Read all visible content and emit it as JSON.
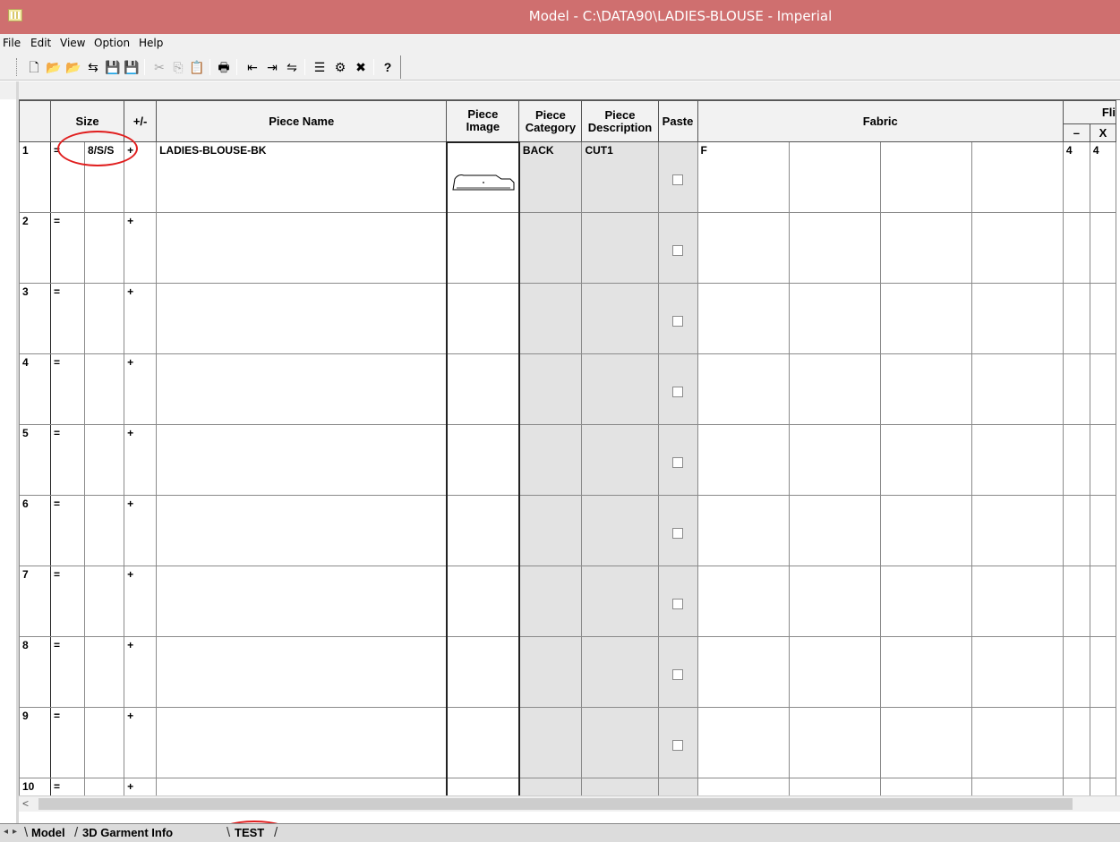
{
  "window": {
    "title": "Model - C:\\DATA90\\LADIES-BLOUSE - Imperial"
  },
  "menu": [
    "File",
    "Edit",
    "View",
    "Option",
    "Help"
  ],
  "toolbar": {
    "icons": [
      "new-icon",
      "open-icon",
      "open-folder-icon",
      "import-icon",
      "save-icon",
      "save-all-icon",
      "cut-icon",
      "copy-icon",
      "paste-icon",
      "print-icon",
      "insert-row-icon",
      "append-row-icon",
      "delete-row-icon",
      "sort-icon",
      "properties-icon",
      "delete-icon",
      "help-icon"
    ],
    "glyphs": [
      "🗋",
      "📂",
      "📂",
      "⇆",
      "💾",
      "💾",
      "✂",
      "⎘",
      "📋",
      "🖶",
      "⇤",
      "⇥",
      "⇋",
      "☰",
      "⚙",
      "✖",
      "?"
    ]
  },
  "columns": {
    "size": "Size",
    "plusminus": "+/-",
    "piece_name": "Piece Name",
    "piece_image": "Piece\nImage",
    "piece_category": "Piece\nCategory",
    "piece_description": "Piece\nDescription",
    "paste": "Paste",
    "fabric": "Fabric",
    "flip": "Fli",
    "flip_minus": "–",
    "flip_x": "X"
  },
  "rows": [
    {
      "num": "1",
      "eq": "=",
      "size": "8/S/S",
      "plus": "+",
      "name": "LADIES-BLOUSE-BK",
      "category": "BACK",
      "description": "CUT1",
      "fabric": "F",
      "flip_minus": "4",
      "flip_x": "4",
      "has_image": true
    },
    {
      "num": "2",
      "eq": "=",
      "size": "",
      "plus": "+",
      "name": "",
      "category": "",
      "description": "",
      "fabric": "",
      "flip_minus": "",
      "flip_x": ""
    },
    {
      "num": "3",
      "eq": "=",
      "size": "",
      "plus": "+",
      "name": "",
      "category": "",
      "description": "",
      "fabric": "",
      "flip_minus": "",
      "flip_x": ""
    },
    {
      "num": "4",
      "eq": "=",
      "size": "",
      "plus": "+",
      "name": "",
      "category": "",
      "description": "",
      "fabric": "",
      "flip_minus": "",
      "flip_x": ""
    },
    {
      "num": "5",
      "eq": "=",
      "size": "",
      "plus": "+",
      "name": "",
      "category": "",
      "description": "",
      "fabric": "",
      "flip_minus": "",
      "flip_x": ""
    },
    {
      "num": "6",
      "eq": "=",
      "size": "",
      "plus": "+",
      "name": "",
      "category": "",
      "description": "",
      "fabric": "",
      "flip_minus": "",
      "flip_x": ""
    },
    {
      "num": "7",
      "eq": "=",
      "size": "",
      "plus": "+",
      "name": "",
      "category": "",
      "description": "",
      "fabric": "",
      "flip_minus": "",
      "flip_x": ""
    },
    {
      "num": "8",
      "eq": "=",
      "size": "",
      "plus": "+",
      "name": "",
      "category": "",
      "description": "",
      "fabric": "",
      "flip_minus": "",
      "flip_x": ""
    },
    {
      "num": "9",
      "eq": "=",
      "size": "",
      "plus": "+",
      "name": "",
      "category": "",
      "description": "",
      "fabric": "",
      "flip_minus": "",
      "flip_x": ""
    },
    {
      "num": "10",
      "eq": "=",
      "size": "",
      "plus": "+",
      "name": "",
      "category": "",
      "description": "",
      "fabric": "",
      "flip_minus": "",
      "flip_x": ""
    }
  ],
  "sheet_tabs": [
    "Model",
    "3D Garment Info",
    "TEST"
  ],
  "active_tab": "TEST",
  "annotation_color": "#e01e1e"
}
